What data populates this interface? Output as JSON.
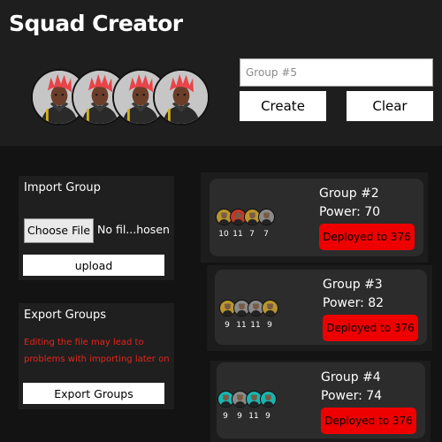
{
  "app_title": "Squad Creator",
  "squad_slots": [
    {
      "icon": "character-avatar-icon"
    },
    {
      "icon": "character-avatar-icon"
    },
    {
      "icon": "character-avatar-icon"
    },
    {
      "icon": "character-avatar-icon"
    }
  ],
  "group_input": {
    "placeholder": "Group #5",
    "value": ""
  },
  "buttons": {
    "create": "Create",
    "clear": "Clear"
  },
  "import_panel": {
    "title": "Import Group",
    "choose_file": "Choose File",
    "file_name": "No fil...hosen",
    "upload": "upload"
  },
  "export_panel": {
    "title": "Export Groups",
    "warning": "Editing the file may lead to problems with importing later on",
    "export": "Export Groups"
  },
  "colors": {
    "deploy": "#ef0000",
    "warning": "#e8241c",
    "mini_gold": "#b8962e",
    "mini_red": "#c0392b",
    "mini_gray": "#8a8a8a",
    "mini_teal": "#19b5b0"
  },
  "groups": [
    {
      "name": "Group #2",
      "power": "Power: 70",
      "deploy": "Deployed to 376",
      "members": [
        {
          "level": "10",
          "color": "gold"
        },
        {
          "level": "11",
          "color": "red"
        },
        {
          "level": "7",
          "color": "gold"
        },
        {
          "level": "7",
          "color": "gray"
        }
      ]
    },
    {
      "name": "Group #3",
      "power": "Power: 82",
      "deploy": "Deployed to 376",
      "members": [
        {
          "level": "9",
          "color": "gold"
        },
        {
          "level": "11",
          "color": "gray"
        },
        {
          "level": "11",
          "color": "gray"
        },
        {
          "level": "9",
          "color": "gold"
        }
      ]
    },
    {
      "name": "Group #4",
      "power": "Power: 74",
      "deploy": "Deployed to 376",
      "members": [
        {
          "level": "9",
          "color": "teal"
        },
        {
          "level": "9",
          "color": "gray"
        },
        {
          "level": "11",
          "color": "teal"
        },
        {
          "level": "9",
          "color": "teal"
        }
      ]
    }
  ]
}
